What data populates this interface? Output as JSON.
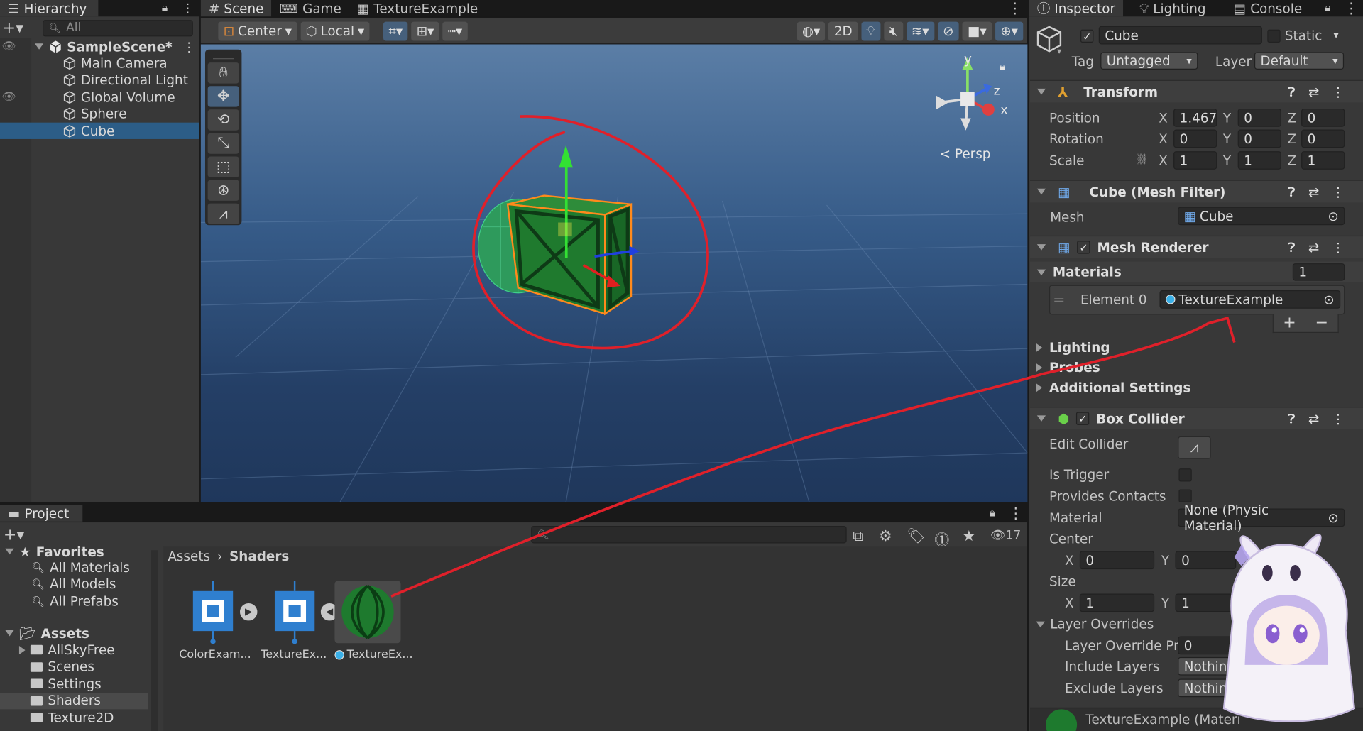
{
  "hierarchy": {
    "tab": "Hierarchy",
    "search_placeholder": "All",
    "scene": "SampleScene*",
    "items": [
      {
        "label": "Main Camera"
      },
      {
        "label": "Directional Light"
      },
      {
        "label": "Global Volume"
      },
      {
        "label": "Sphere"
      },
      {
        "label": "Cube",
        "selected": true
      }
    ]
  },
  "scene_view": {
    "tabs": [
      "Scene",
      "Game",
      "TextureExample"
    ],
    "pivot_label": "Center",
    "space_label": "Local",
    "mode_2d": "2D",
    "persp_label": "Persp",
    "gizmo_axes": {
      "y": "y",
      "z": "z",
      "x": "x"
    }
  },
  "inspector": {
    "tabs": [
      "Inspector",
      "Lighting",
      "Console"
    ],
    "object_name": "Cube",
    "static_label": "Static",
    "tag_label": "Tag",
    "tag_value": "Untagged",
    "layer_label": "Layer",
    "layer_value": "Default",
    "transform": {
      "title": "Transform",
      "position_label": "Position",
      "position": {
        "x": "1.467",
        "y": "0",
        "z": "0"
      },
      "rotation_label": "Rotation",
      "rotation": {
        "x": "0",
        "y": "0",
        "z": "0"
      },
      "scale_label": "Scale",
      "scale": {
        "x": "1",
        "y": "1",
        "z": "1"
      }
    },
    "mesh_filter": {
      "title": "Cube (Mesh Filter)",
      "mesh_label": "Mesh",
      "mesh_value": "Cube"
    },
    "mesh_renderer": {
      "title": "Mesh Renderer",
      "materials_label": "Materials",
      "materials_count": "1",
      "element0_label": "Element 0",
      "element0_value": "TextureExample",
      "lighting": "Lighting",
      "probes": "Probes",
      "additional": "Additional Settings"
    },
    "box_collider": {
      "title": "Box Collider",
      "edit_collider": "Edit Collider",
      "is_trigger": "Is Trigger",
      "provides_contacts": "Provides Contacts",
      "material_label": "Material",
      "material_value": "None (Physic Material)",
      "center_label": "Center",
      "center": {
        "x": "0",
        "y": "0"
      },
      "size_label": "Size",
      "size": {
        "x": "1",
        "y": "1"
      },
      "layer_overrides": "Layer Overrides",
      "layer_override_priority": "Layer Override Pri",
      "layer_override_priority_value": "0",
      "include_layers": "Include Layers",
      "include_value": "Nothin",
      "exclude_layers": "Exclude Layers",
      "exclude_value": "Nothin"
    },
    "footer_material": "TextureExample (Materi"
  },
  "project": {
    "tab": "Project",
    "hidden_count": "17",
    "favorites_label": "Favorites",
    "favorites": [
      "All Materials",
      "All Models",
      "All Prefabs"
    ],
    "assets_label": "Assets",
    "folders": [
      "AllSkyFree",
      "Scenes",
      "Settings",
      "Shaders",
      "Texture2D"
    ],
    "breadcrumb": [
      "Assets",
      "Shaders"
    ],
    "files": [
      "ColorExam...",
      "TextureEx...",
      "TextureEx..."
    ]
  },
  "colors": {
    "annotation": "#e0202a",
    "selection": "#2c5d87",
    "crate": "#1f7a2e"
  }
}
